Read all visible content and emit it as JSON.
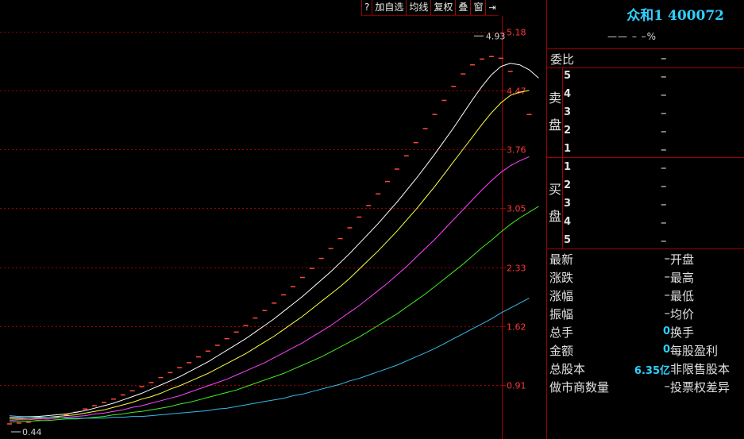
{
  "toolbar": {
    "buttons": [
      {
        "label": "?"
      },
      {
        "label": "加自选"
      },
      {
        "label": "均线"
      },
      {
        "label": "复权"
      },
      {
        "label": "叠"
      },
      {
        "label": "窗"
      },
      {
        "label": "⇥"
      }
    ]
  },
  "chart_data": {
    "type": "line",
    "y_ticks": [
      "5.18",
      "4.47",
      "3.76",
      "3.05",
      "2.33",
      "1.62",
      "0.91"
    ],
    "ylim": [
      0.4,
      5.6
    ],
    "annotations": {
      "high": "4.93",
      "low": "0.44"
    },
    "x": [
      0,
      2,
      4,
      6,
      8,
      10,
      12,
      14,
      16,
      18,
      20,
      22,
      24,
      26,
      28,
      30,
      32,
      34,
      36,
      38,
      40,
      42,
      44,
      46,
      48,
      50,
      52,
      54,
      56,
      58,
      60,
      62,
      64,
      66,
      68,
      70,
      72,
      74,
      76,
      78,
      80,
      82,
      84,
      86,
      88,
      90,
      92,
      94,
      96,
      98,
      100,
      102,
      104,
      106,
      108,
      110,
      112,
      114,
      116,
      118,
      120
    ],
    "series": [
      {
        "color": "#ff4a3a",
        "style": "price-marks",
        "values": [
          0.44,
          0.45,
          0.46,
          0.48,
          0.5,
          0.52,
          0.55,
          0.58,
          0.62,
          0.66,
          0.7,
          0.74,
          0.79,
          0.84,
          0.89,
          0.94,
          1.0,
          1.06,
          1.12,
          1.18,
          1.25,
          1.32,
          1.39,
          1.47,
          1.55,
          1.63,
          1.72,
          1.81,
          1.9,
          2.0,
          2.1,
          2.21,
          2.32,
          2.44,
          2.56,
          2.68,
          2.81,
          2.94,
          3.08,
          3.22,
          3.37,
          3.52,
          3.68,
          3.84,
          4.01,
          4.18,
          4.35,
          4.52,
          4.67,
          4.78,
          4.85,
          4.88,
          4.86,
          4.7,
          4.45,
          4.18,
          null,
          null,
          null,
          null,
          null
        ]
      },
      {
        "color": "#ffffff",
        "values": [
          0.52,
          0.52,
          0.53,
          0.53,
          0.54,
          0.55,
          0.56,
          0.58,
          0.6,
          0.63,
          0.66,
          0.69,
          0.73,
          0.77,
          0.81,
          0.86,
          0.91,
          0.96,
          1.01,
          1.07,
          1.13,
          1.19,
          1.26,
          1.33,
          1.4,
          1.47,
          1.55,
          1.63,
          1.71,
          1.8,
          1.89,
          1.98,
          2.08,
          2.18,
          2.28,
          2.39,
          2.5,
          2.62,
          2.74,
          2.86,
          2.99,
          3.12,
          3.26,
          3.4,
          3.55,
          3.7,
          3.86,
          4.02,
          4.19,
          4.36,
          4.52,
          4.66,
          4.76,
          4.8,
          4.78,
          4.72,
          4.62,
          null,
          null,
          null,
          null
        ]
      },
      {
        "color": "#ffff44",
        "values": [
          0.5,
          0.5,
          0.51,
          0.51,
          0.52,
          0.53,
          0.54,
          0.55,
          0.57,
          0.59,
          0.61,
          0.64,
          0.67,
          0.7,
          0.74,
          0.77,
          0.81,
          0.86,
          0.9,
          0.95,
          1.0,
          1.05,
          1.11,
          1.17,
          1.23,
          1.29,
          1.36,
          1.43,
          1.5,
          1.58,
          1.66,
          1.74,
          1.83,
          1.92,
          2.01,
          2.1,
          2.2,
          2.31,
          2.42,
          2.53,
          2.65,
          2.77,
          2.9,
          3.03,
          3.17,
          3.31,
          3.46,
          3.61,
          3.76,
          3.91,
          4.06,
          4.2,
          4.32,
          4.41,
          4.45,
          4.47,
          null,
          null,
          null,
          null,
          null
        ]
      },
      {
        "color": "#ff44ff",
        "values": [
          0.48,
          0.49,
          0.49,
          0.5,
          0.5,
          0.51,
          0.52,
          0.53,
          0.54,
          0.56,
          0.57,
          0.59,
          0.61,
          0.64,
          0.66,
          0.69,
          0.72,
          0.75,
          0.78,
          0.82,
          0.86,
          0.9,
          0.94,
          0.98,
          1.03,
          1.08,
          1.13,
          1.18,
          1.24,
          1.3,
          1.36,
          1.42,
          1.49,
          1.56,
          1.63,
          1.71,
          1.79,
          1.87,
          1.96,
          2.05,
          2.14,
          2.24,
          2.34,
          2.45,
          2.56,
          2.67,
          2.79,
          2.91,
          3.03,
          3.15,
          3.27,
          3.38,
          3.48,
          3.56,
          3.62,
          3.67,
          null,
          null,
          null,
          null,
          null
        ]
      },
      {
        "color": "#44ee22",
        "values": [
          0.46,
          0.47,
          0.47,
          0.48,
          0.48,
          0.49,
          0.5,
          0.5,
          0.51,
          0.52,
          0.53,
          0.55,
          0.56,
          0.58,
          0.59,
          0.61,
          0.63,
          0.65,
          0.68,
          0.7,
          0.73,
          0.76,
          0.79,
          0.82,
          0.85,
          0.89,
          0.93,
          0.97,
          1.01,
          1.05,
          1.1,
          1.15,
          1.2,
          1.25,
          1.31,
          1.37,
          1.43,
          1.49,
          1.56,
          1.63,
          1.7,
          1.77,
          1.85,
          1.93,
          2.01,
          2.1,
          2.19,
          2.28,
          2.37,
          2.47,
          2.57,
          2.66,
          2.76,
          2.85,
          2.93,
          3.0,
          3.07,
          null,
          null,
          null,
          null
        ]
      },
      {
        "color": "#33bbee",
        "values": [
          0.54,
          0.53,
          0.53,
          0.52,
          0.52,
          0.52,
          0.51,
          0.51,
          0.51,
          0.51,
          0.51,
          0.52,
          0.52,
          0.53,
          0.53,
          0.54,
          0.55,
          0.56,
          0.57,
          0.58,
          0.59,
          0.6,
          0.62,
          0.63,
          0.65,
          0.67,
          0.69,
          0.71,
          0.73,
          0.75,
          0.78,
          0.8,
          0.83,
          0.86,
          0.89,
          0.92,
          0.96,
          0.99,
          1.03,
          1.07,
          1.11,
          1.15,
          1.2,
          1.25,
          1.3,
          1.35,
          1.41,
          1.47,
          1.53,
          1.59,
          1.65,
          1.71,
          1.78,
          1.84,
          1.9,
          1.96,
          null,
          null,
          null,
          null,
          null
        ]
      }
    ]
  },
  "quote": {
    "title": "众和1 400072",
    "subtitle": "—— – –%",
    "webi_label": "委比",
    "webi_value": "–",
    "sell_label_1": "卖",
    "sell_label_2": "盘",
    "buy_label_1": "买",
    "buy_label_2": "盘",
    "sell_rows": [
      {
        "n": "5",
        "v": "–"
      },
      {
        "n": "4",
        "v": "–"
      },
      {
        "n": "3",
        "v": "–"
      },
      {
        "n": "2",
        "v": "–"
      },
      {
        "n": "1",
        "v": "–"
      }
    ],
    "buy_rows": [
      {
        "n": "1",
        "v": "–"
      },
      {
        "n": "2",
        "v": "–"
      },
      {
        "n": "3",
        "v": "–"
      },
      {
        "n": "4",
        "v": "–"
      },
      {
        "n": "5",
        "v": "–"
      }
    ],
    "info_rows": [
      {
        "l": "最新",
        "v": "–",
        "r": "开盘"
      },
      {
        "l": "涨跌",
        "v": "–",
        "r": "最高"
      },
      {
        "l": "涨幅",
        "v": "–",
        "r": "最低"
      },
      {
        "l": "振幅",
        "v": "–",
        "r": "均价"
      },
      {
        "l": "总手",
        "v": "0",
        "r": "换手"
      },
      {
        "l": "金额",
        "v": "0",
        "r": "每股盈利"
      },
      {
        "l": "总股本",
        "v": "6.35亿",
        "r": "非限售股本"
      },
      {
        "l": "做市商数量",
        "v": "–",
        "r": "投票权差异"
      }
    ]
  },
  "colors": {
    "grid": "#a00000",
    "axis_text": "#ff3838",
    "accent": "#2fd0ff"
  }
}
